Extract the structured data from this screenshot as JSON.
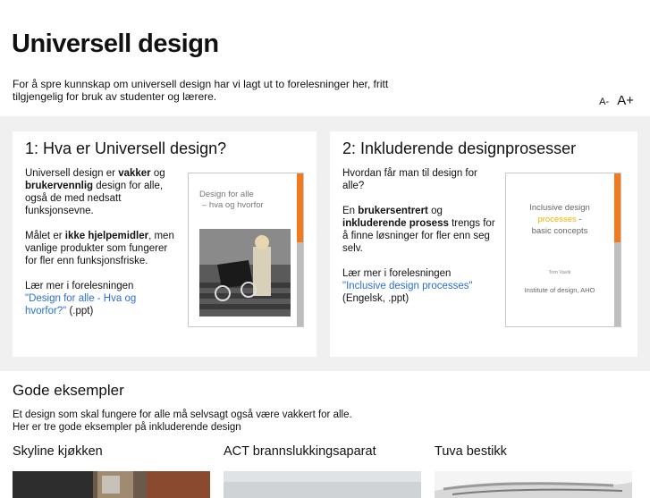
{
  "header": {
    "title": "Universell design",
    "intro": "For å spre kunnskap om universell design har vi lagt ut to forelesninger her, fritt tilgjengelig for bruk av studenter og lærere.",
    "font_small": "A-",
    "font_large": "A+"
  },
  "cards": [
    {
      "heading": "1: Hva er Universell design?",
      "p1": [
        "Universell design er ",
        "vakker",
        " og ",
        "brukervennlig",
        " design for alle, også de med nedsatt funksjonsevne."
      ],
      "p2": [
        "Målet er ",
        "ikke hjelpemidler",
        ", men vanlige produkter som fungerer for fler enn funksjonsfriske."
      ],
      "p3_pre": "Lær mer i forelesningen",
      "link": "\"Design for alle - Hva og hvorfor?\"",
      "suffix": " (.ppt)",
      "slide_line1": "Design for alle",
      "slide_line2": "– hva og hvorfor"
    },
    {
      "heading": "2: Inkluderende designprosesser",
      "p1": "Hvordan får man til design for alle?",
      "p2": [
        "En ",
        "brukersentrert",
        " og ",
        "inkluderende prosess",
        " trengs for å finne løsninger for fler enn seg selv."
      ],
      "p3_pre": "Lær mer i forelesningen",
      "link": "\"Inclusive design processes\"",
      "suffix": "(Engelsk, .ppt)",
      "slide_line1": "Inclusive design",
      "slide_line2": "processes",
      "slide_line2_suffix": " -",
      "slide_line3": "basic concepts",
      "slide_author": "Tom Vavik",
      "slide_inst": "Institute of design, AHO"
    }
  ],
  "examples": {
    "title": "Gode eksempler",
    "line1": "Et design som skal fungere for alle må selvsagt også være vakkert for alle.",
    "line2": "Her er tre gode eksempler på inkluderende design",
    "items": [
      {
        "name": "Skyline kjøkken"
      },
      {
        "name": "ACT brannslukkingsaparat"
      },
      {
        "name": "Tuva bestikk"
      }
    ]
  },
  "colors": {
    "link": "#2a6fd6",
    "accent_orange": "#f07a1e",
    "highlight_yellow": "#f0b400",
    "band": "#f0f0f0"
  }
}
